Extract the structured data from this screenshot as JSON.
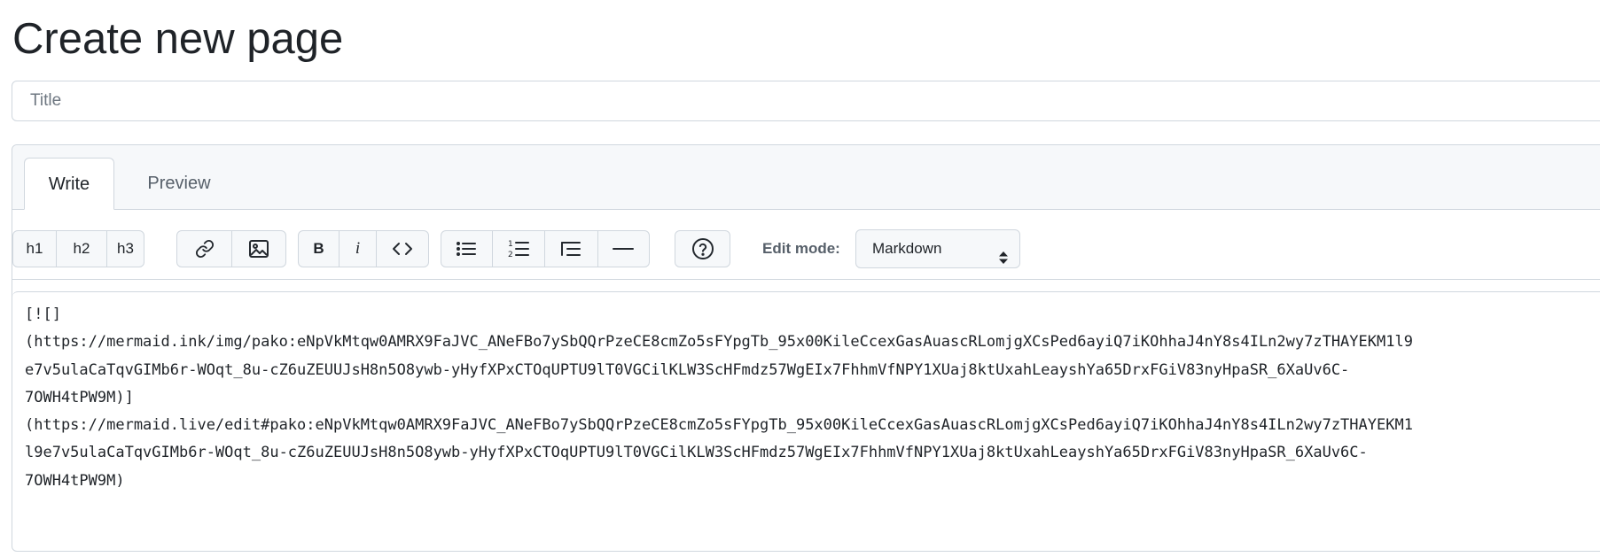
{
  "page": {
    "title": "Create new page"
  },
  "title_field": {
    "placeholder": "Title",
    "value": ""
  },
  "tabs": [
    {
      "label": "Write",
      "active": true
    },
    {
      "label": "Preview",
      "active": false
    }
  ],
  "toolbar": {
    "h1": "h1",
    "h2": "h2",
    "h3": "h3",
    "bold": "B",
    "italic": "i",
    "icons": [
      "link-icon",
      "image-icon",
      "code-icon",
      "unordered-list-icon",
      "ordered-list-icon",
      "task-list-icon",
      "horizontal-rule-icon",
      "help-icon"
    ],
    "edit_mode_label": "Edit mode:",
    "edit_mode_value": "Markdown"
  },
  "editor": {
    "lines": [
      "[![]",
      "(https://mermaid.ink/img/pako:eNpVkMtqw0AMRX9FaJVC_ANeFBo7ySbQQrPzeCE8cmZo5sFYpgTb_95x00KileCcexGasAuascRLomjgXCsPed6ayiQ7iKOhhaJ4nY8s4ILn2wy7zTHAYEKM1l9",
      "e7v5ulaCaTqvGIMb6r-WOqt_8u-cZ6uZEUUJsH8n5O8ywb-yHyfXPxCTOqUPTU9lT0VGCilKLW3ScHFmdz57WgEIx7FhhmVfNPY1XUaj8ktUxahLeayshYa65DrxFGiV83nyHpaSR_6XaUv6C-",
      "7OWH4tPW9M)]",
      "(https://mermaid.live/edit#pako:eNpVkMtqw0AMRX9FaJVC_ANeFBo7ySbQQrPzeCE8cmZo5sFYpgTb_95x00KileCcexGasAuascRLomjgXCsPed6ayiQ7iKOhhaJ4nY8s4ILn2wy7zTHAYEKM1",
      "l9e7v5ulaCaTqvGIMb6r-WOqt_8u-cZ6uZEUUJsH8n5O8ywb-yHyfXPxCTOqUPTU9lT0VGCilKLW3ScHFmdz57WgEIx7FhhmVfNPY1XUaj8ktUxahLeayshYa65DrxFGiV83nyHpaSR_6XaUv6C-",
      "7OWH4tPW9M)"
    ]
  },
  "colors": {
    "border": "#d0d7de",
    "toolbar_bg": "#f6f8fa",
    "text": "#1f2328",
    "muted": "#57606a"
  }
}
